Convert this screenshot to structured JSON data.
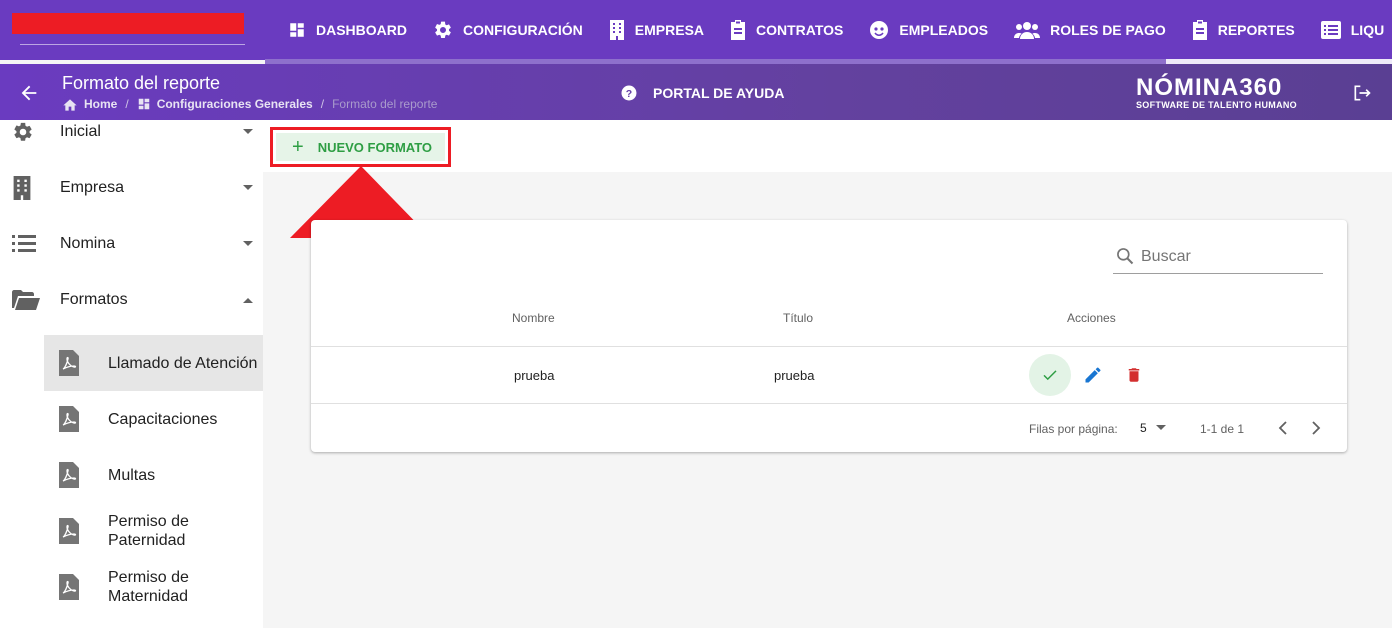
{
  "topnav": {
    "items": [
      {
        "label": "DASHBOARD",
        "icon": "dashboard-icon"
      },
      {
        "label": "CONFIGURACIÓN",
        "icon": "gear-icon"
      },
      {
        "label": "EMPRESA",
        "icon": "building-icon"
      },
      {
        "label": "CONTRATOS",
        "icon": "clipboard-icon"
      },
      {
        "label": "EMPLEADOS",
        "icon": "face-icon"
      },
      {
        "label": "ROLES DE PAGO",
        "icon": "users-icon"
      },
      {
        "label": "REPORTES",
        "icon": "clipboard-icon"
      },
      {
        "label": "LIQU",
        "icon": "list-icon"
      }
    ]
  },
  "subheader": {
    "title": "Formato del reporte",
    "breadcrumb": {
      "home": "Home",
      "section": "Configuraciones Generales",
      "current": "Formato del reporte"
    },
    "help_label": "PORTAL DE AYUDA",
    "logo_main": "NÓMINA360",
    "logo_sub": "SOFTWARE DE TALENTO HUMANO"
  },
  "sidebar": {
    "items": [
      {
        "label": "Inicial",
        "icon": "gear-icon"
      },
      {
        "label": "Empresa",
        "icon": "building-icon"
      },
      {
        "label": "Nomina",
        "icon": "list-icon"
      },
      {
        "label": "Formatos",
        "icon": "folder-open-icon"
      }
    ],
    "subitems": [
      {
        "label": "Llamado de Atención",
        "active": true
      },
      {
        "label": "Capacitaciones",
        "active": false
      },
      {
        "label": "Multas",
        "active": false
      },
      {
        "label": "Permiso de Paternidad",
        "line1": "Permiso de",
        "line2": "Paternidad",
        "active": false
      },
      {
        "label": "Permiso de Maternidad",
        "line1": "Permiso de",
        "line2": "Maternidad",
        "active": false
      }
    ]
  },
  "toolbar": {
    "new_label": "NUEVO FORMATO"
  },
  "table": {
    "search_placeholder": "Buscar",
    "headers": {
      "name": "Nombre",
      "title": "Título",
      "actions": "Acciones"
    },
    "rows": [
      {
        "name": "prueba",
        "title": "prueba"
      }
    ],
    "footer": {
      "rows_per_page_label": "Filas por página:",
      "rows_per_page_value": "5",
      "range": "1-1 de 1"
    }
  },
  "colors": {
    "primary": "#6a3bc0",
    "highlight": "#ed1c24",
    "success": "#2e9e44",
    "edit": "#1976d2",
    "delete": "#d32f2f"
  }
}
